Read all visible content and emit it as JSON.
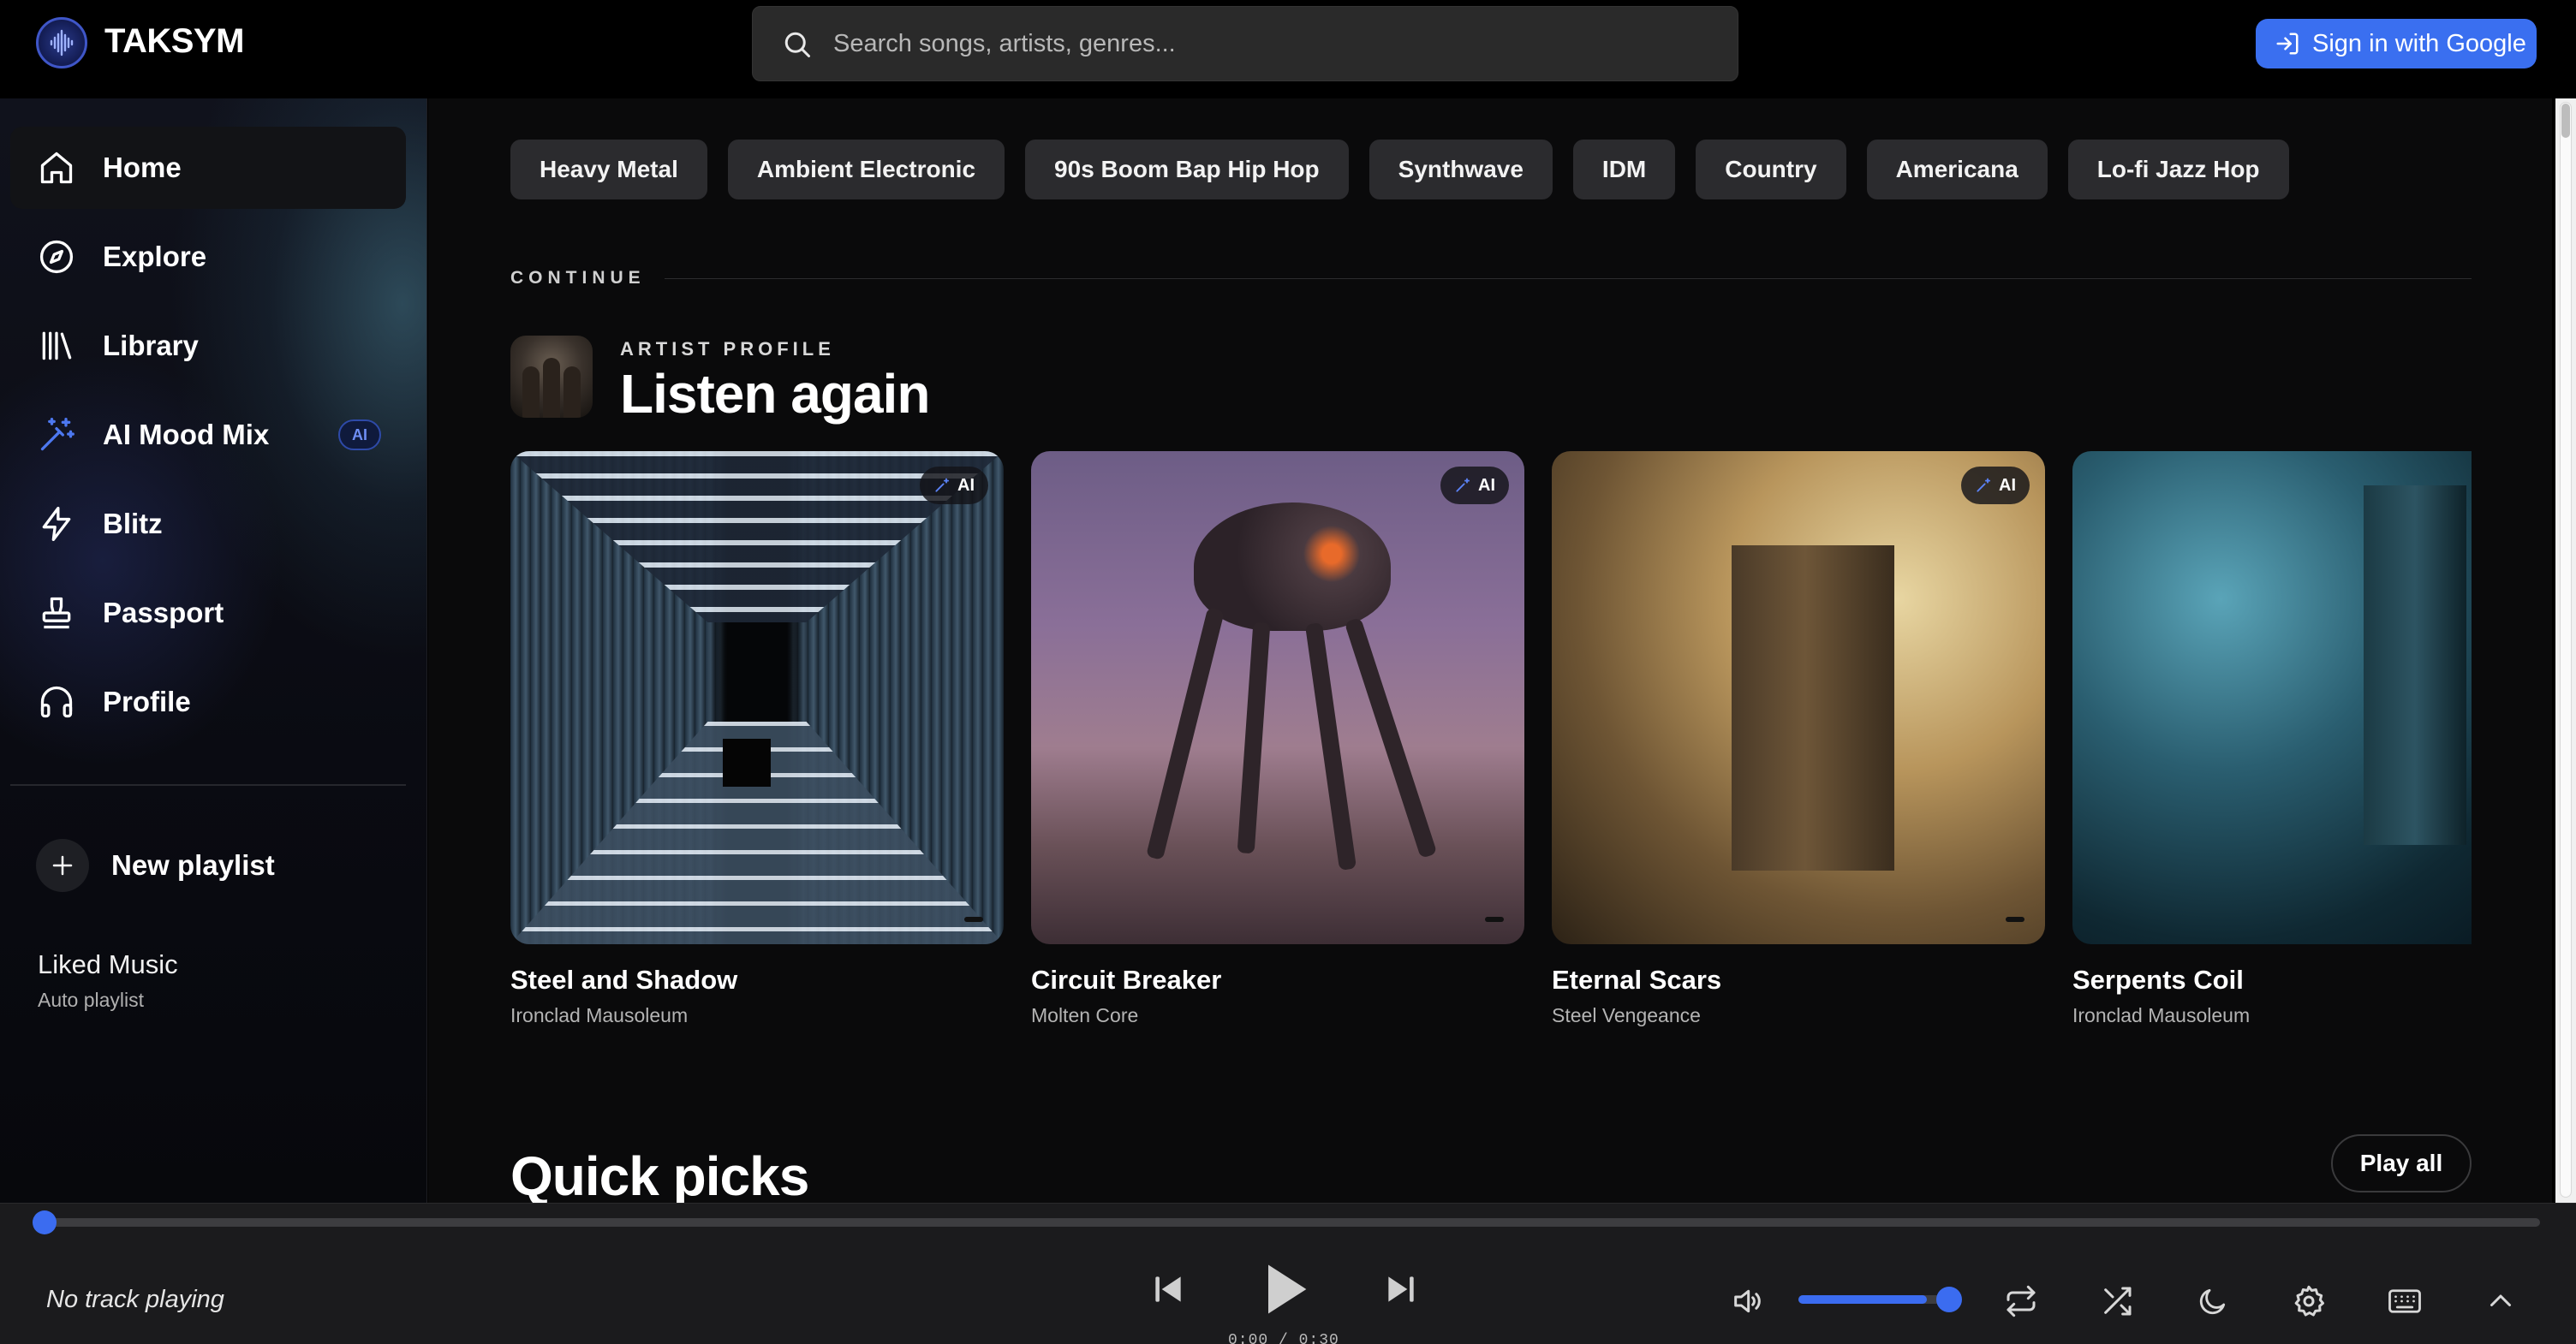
{
  "app": {
    "brand": "TAKSYM"
  },
  "search": {
    "placeholder": "Search songs, artists, genres..."
  },
  "auth": {
    "signin_label": "Sign in with Google"
  },
  "sidebar": {
    "items": [
      {
        "label": "Home",
        "icon": "home-icon",
        "active": true
      },
      {
        "label": "Explore",
        "icon": "compass-icon"
      },
      {
        "label": "Library",
        "icon": "library-icon"
      },
      {
        "label": "AI Mood Mix",
        "icon": "magic-wand-icon",
        "badge": "AI"
      },
      {
        "label": "Blitz",
        "icon": "lightning-icon"
      },
      {
        "label": "Passport",
        "icon": "stamp-icon"
      },
      {
        "label": "Profile",
        "icon": "headphones-icon"
      }
    ],
    "new_playlist_label": "New playlist",
    "playlists": [
      {
        "title": "Liked Music",
        "subtitle": "Auto playlist"
      }
    ]
  },
  "main": {
    "genres": [
      "Heavy Metal",
      "Ambient Electronic",
      "90s Boom Bap Hip Hop",
      "Synthwave",
      "IDM",
      "Country",
      "Americana",
      "Lo-fi Jazz Hop"
    ],
    "continue_label": "CONTINUE",
    "section": {
      "eyebrow": "ARTIST PROFILE",
      "title": "Listen again",
      "cards": [
        {
          "title": "Steel and Shadow",
          "artist": "Ironclad Mausoleum",
          "ai_tag": "AI"
        },
        {
          "title": "Circuit Breaker",
          "artist": "Molten Core",
          "ai_tag": "AI"
        },
        {
          "title": "Eternal Scars",
          "artist": "Steel Vengeance",
          "ai_tag": "AI"
        },
        {
          "title": "Serpents Coil",
          "artist": "Ironclad Mausoleum",
          "ai_tag": ""
        }
      ]
    },
    "quick_picks": {
      "title": "Quick picks",
      "play_all_label": "Play all"
    }
  },
  "player": {
    "now_playing": "No track playing",
    "time": "0:00 / 0:30",
    "progress": 0,
    "volume": 0.85
  },
  "colors": {
    "accent": "#3b6cf0",
    "signin": "#3a6ff0",
    "background": "#0a0a0b",
    "sidebar_active": "#121316"
  }
}
